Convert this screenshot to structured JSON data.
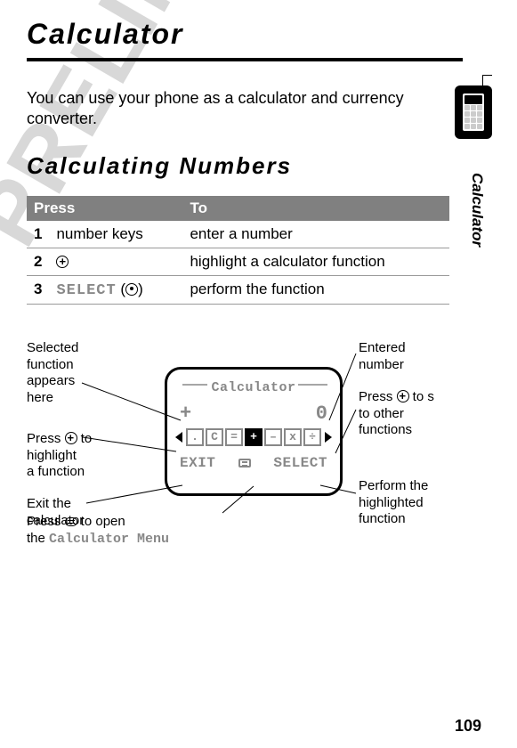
{
  "watermark": "PRELIMINARY",
  "title": "Calculator",
  "intro": "You can use your phone as a calculator and currency converter.",
  "subtitle": "Calculating Numbers",
  "table": {
    "headers": [
      "Press",
      "To"
    ],
    "rows": [
      {
        "num": "1",
        "press": "number keys",
        "to": "enter a number"
      },
      {
        "num": "2",
        "press_icon": "nav-icon",
        "to": "highlight a calculator function"
      },
      {
        "num": "3",
        "press_label": "SELECT",
        "to": "perform the function"
      }
    ]
  },
  "screen": {
    "title": "Calculator",
    "operator": "+",
    "value": "0",
    "functions": [
      ".",
      "C",
      "=",
      "+",
      "–",
      "x",
      "÷"
    ],
    "left_soft": "EXIT",
    "right_soft": "SELECT"
  },
  "callouts": {
    "selected": "Selected\nfunction\nappears\nhere",
    "press_nav": "Press      to\nhighlight\na function",
    "exit": "Exit the\ncalculator",
    "press_menu": "Press      to open\nthe ",
    "menu_name": "Calculator Menu",
    "entered": "Entered\nnumber",
    "press_scroll": "Press      to s\nto other\nfunctions",
    "perform": "Perform the\nhighlighted\nfunction"
  },
  "sidebar": "Calculator",
  "page": "109"
}
